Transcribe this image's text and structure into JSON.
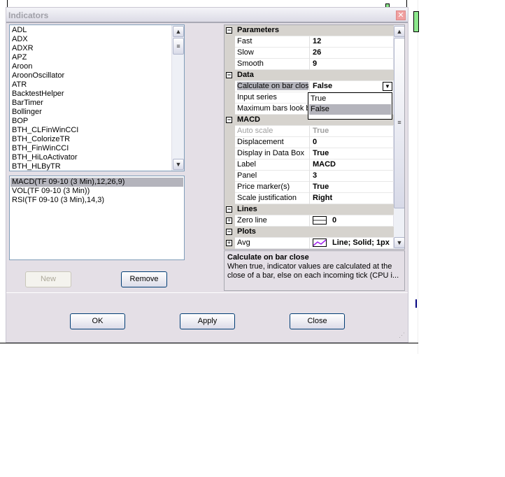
{
  "dialog": {
    "title": "Indicators"
  },
  "available_indicators": [
    "ADL",
    "ADX",
    "ADXR",
    "APZ",
    "Aroon",
    "AroonOscillator",
    "ATR",
    "BacktestHelper",
    "BarTimer",
    "Bollinger",
    "BOP",
    "BTH_CLFinWinCCI",
    "BTH_ColorizeTR",
    "BTH_FinWinCCI",
    "BTH_HiLoActivator",
    "BTH_HLByTR"
  ],
  "applied_indicators": [
    "MACD(TF 09-10 (3 Min),12,26,9)",
    "VOL(TF 09-10 (3 Min))",
    "RSI(TF 09-10 (3 Min),14,3)"
  ],
  "buttons": {
    "new": "New",
    "remove": "Remove",
    "ok": "OK",
    "apply": "Apply",
    "close": "Close"
  },
  "properties": {
    "parameters": {
      "label": "Parameters",
      "fast_label": "Fast",
      "fast": "12",
      "slow_label": "Slow",
      "slow": "26",
      "smooth_label": "Smooth",
      "smooth": "9"
    },
    "data": {
      "label": "Data",
      "calc_label": "Calculate on bar close",
      "calc": "False",
      "input_label": "Input series",
      "maxbars_label": "Maximum bars look back"
    },
    "dropdown_options": [
      "True",
      "False"
    ],
    "visual": {
      "label": "MACD",
      "autoscale_label": "Auto scale",
      "autoscale": "True",
      "displacement_label": "Displacement",
      "displacement": "0",
      "databox_label": "Display in Data Box",
      "databox": "True",
      "label_label": "Label",
      "panel_label": "Panel",
      "panel": "3",
      "pricemarker_label": "Price marker(s)",
      "pricemarker": "True",
      "scale_label": "Scale justification",
      "scale": "Right"
    },
    "lines": {
      "label": "Lines",
      "zero_label": "Zero line",
      "zero": "0"
    },
    "plots": {
      "label": "Plots",
      "avg_label": "Avg",
      "avg": "Line; Solid; 1px"
    }
  },
  "description": {
    "title": "Calculate on bar close",
    "text": "When true, indicator values are calculated at the close of a bar, else on each incoming tick (CPU i..."
  },
  "colors": {
    "plot": "#a020f0",
    "selection": "#b4b4bc",
    "dialog_bg": "#e4dfe6"
  }
}
